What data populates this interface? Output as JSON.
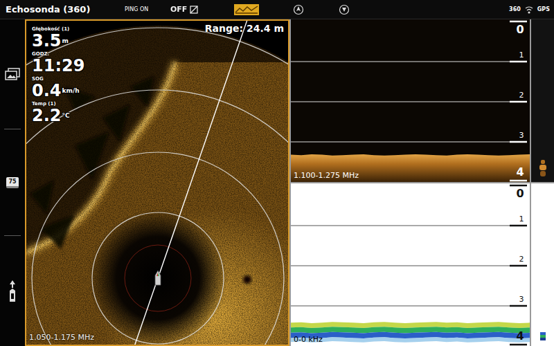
{
  "window": {
    "title": "Echosonda (360)"
  },
  "top_bar": {
    "ping": "PING ON",
    "toggle": {
      "label": "OFF",
      "on": false
    },
    "status": [
      "360",
      "GPS"
    ]
  },
  "sidebar": {
    "items": [
      {
        "kind": "gallery"
      },
      {
        "kind": "zoom",
        "label": "75"
      },
      {
        "kind": "boat"
      }
    ]
  },
  "sonar_360": {
    "range": "Range: 24.4 m",
    "frequency": "1.050-1.175 MHz",
    "readouts": [
      {
        "label": "Głębokość (1)",
        "value": "3.5",
        "unit": "m"
      },
      {
        "label": "GODZ.",
        "value": "11:29"
      },
      {
        "label": "SOG",
        "value": "0.4",
        "unit": "km/h"
      },
      {
        "label": "Temp (1)",
        "value": "2.2",
        "unit": "°C"
      }
    ]
  },
  "echograms": [
    {
      "kind": "down-imaging",
      "frequency": "1.100-1.275 MHz",
      "depth_ticks": [
        "0",
        "1",
        "2",
        "3",
        "4"
      ],
      "bottom_depth": [
        3.32,
        3.33,
        3.31,
        3.32,
        3.34,
        3.33,
        3.32,
        3.31,
        3.33,
        3.34,
        3.33,
        3.32,
        3.31,
        3.32,
        3.33,
        3.34,
        3.32,
        3.31,
        3.32,
        3.33,
        3.34,
        3.33,
        3.32,
        3.31
      ]
    },
    {
      "kind": "2d",
      "frequency": "0-0 kHz",
      "depth_ticks": [
        "0",
        "1",
        "2",
        "3",
        "4"
      ],
      "bottom_depth": [
        3.42,
        3.41,
        3.43,
        3.42,
        3.4,
        3.41,
        3.42,
        3.43,
        3.41,
        3.4,
        3.42,
        3.43,
        3.42,
        3.41,
        3.4,
        3.42,
        3.41,
        3.43,
        3.42,
        3.41,
        3.4,
        3.42,
        3.43,
        3.42
      ]
    }
  ]
}
